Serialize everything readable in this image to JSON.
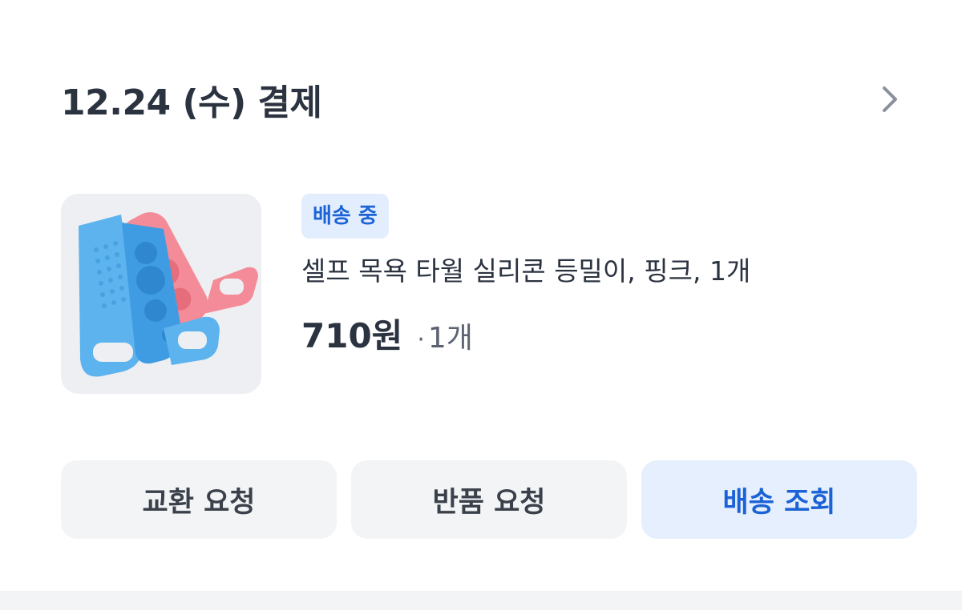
{
  "order": {
    "date_label": "12.24 (수) 결제",
    "chevron_icon": "chevron-right-icon"
  },
  "product": {
    "image_icon": "silicone-back-scrubber-image",
    "status": "배송 중",
    "name": "셀프 목욕 타월 실리콘 등밀이, 핑크, 1개",
    "price": "710원",
    "qty_dot": "·",
    "quantity": "1개"
  },
  "actions": {
    "exchange_label": "교환 요청",
    "return_label": "반품 요청",
    "track_label": "배송 조회"
  },
  "colors": {
    "accent": "#1c64d6",
    "badge_bg": "#e2edfd",
    "button_bg": "#f2f4f6"
  }
}
